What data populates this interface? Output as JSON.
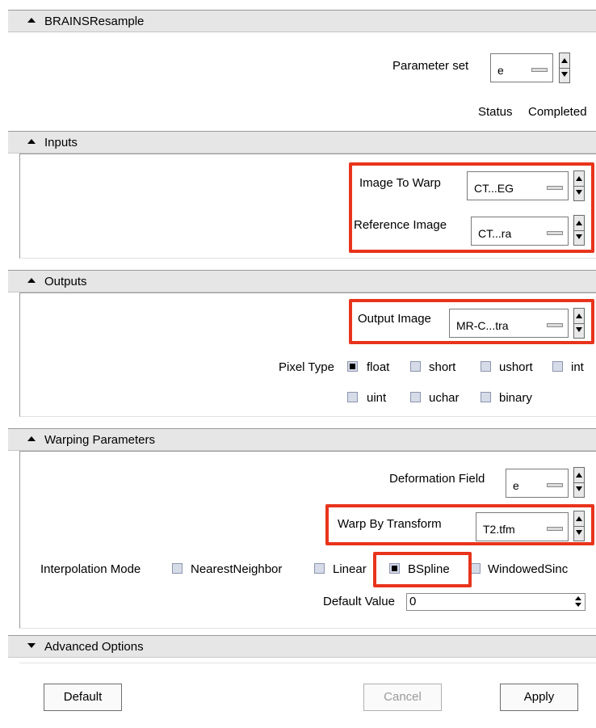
{
  "window": {
    "title": "BRAINSResample"
  },
  "parameter_set": {
    "label": "Parameter set",
    "value": "e"
  },
  "status": {
    "label": "Status",
    "value": "Completed"
  },
  "inputs": {
    "title": "Inputs",
    "image_to_warp": {
      "label": "Image To Warp",
      "value": "CT...EG"
    },
    "reference_image": {
      "label": "Reference Image",
      "value": "CT...ra"
    }
  },
  "outputs": {
    "title": "Outputs",
    "output_image": {
      "label": "Output Image",
      "value": "MR-C...tra"
    },
    "pixel_type": {
      "label": "Pixel Type",
      "options": [
        "float",
        "short",
        "ushort",
        "int",
        "uint",
        "uchar",
        "binary"
      ],
      "selected": "float"
    }
  },
  "warping": {
    "title": "Warping Parameters",
    "deformation_field": {
      "label": "Deformation Field",
      "value": "e"
    },
    "warp_by_transform": {
      "label": "Warp By Transform",
      "value": "T2.tfm"
    },
    "interpolation": {
      "label": "Interpolation Mode",
      "options": [
        "NearestNeighbor",
        "Linear",
        "BSpline",
        "WindowedSinc"
      ],
      "selected": "BSpline"
    },
    "default_value": {
      "label": "Default Value",
      "value": "0"
    }
  },
  "advanced": {
    "title": "Advanced Options"
  },
  "buttons": {
    "default": "Default",
    "cancel": "Cancel",
    "apply": "Apply"
  },
  "colors": {
    "highlight": "#e8341c",
    "header_bg": "#e6e6e6"
  }
}
